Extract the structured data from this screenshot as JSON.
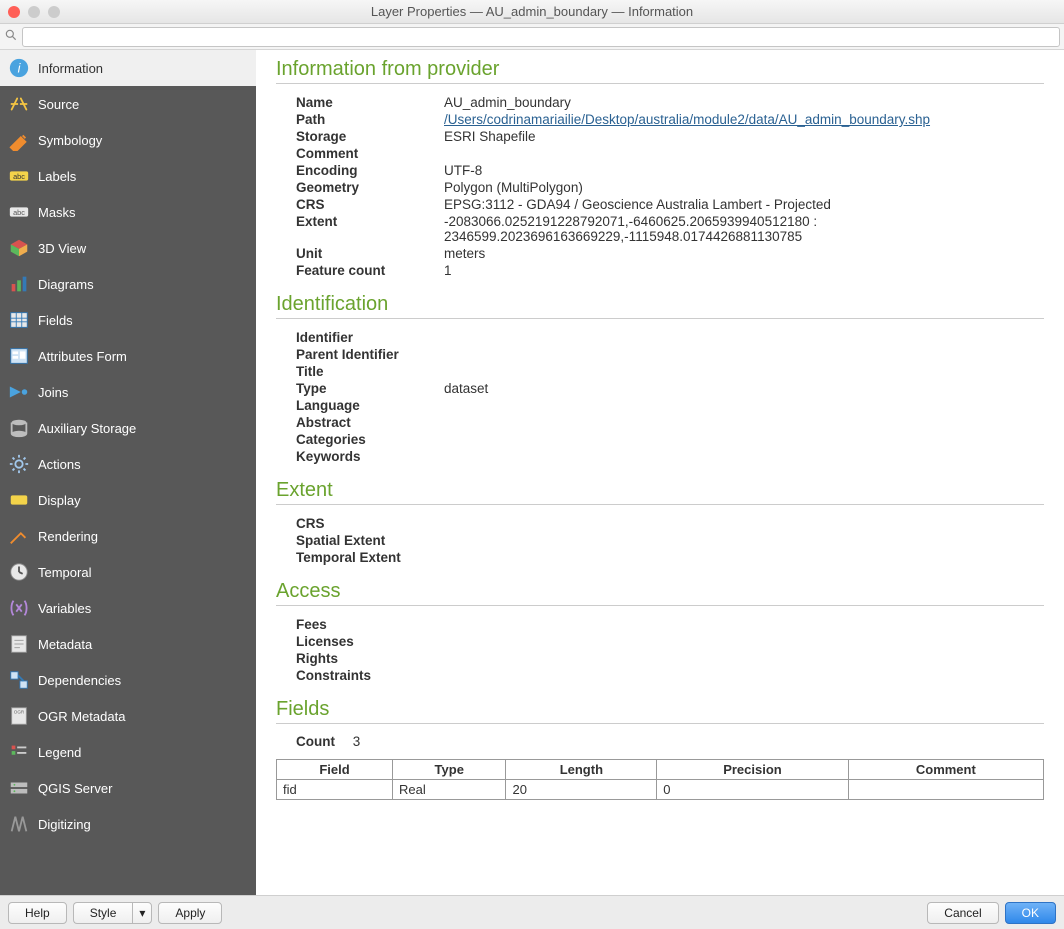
{
  "window": {
    "title": "Layer Properties — AU_admin_boundary — Information"
  },
  "search": {
    "placeholder": ""
  },
  "sidebar": {
    "items": [
      {
        "label": "Information",
        "selected": true,
        "icon": "info-icon"
      },
      {
        "label": "Source",
        "selected": false,
        "icon": "source-icon"
      },
      {
        "label": "Symbology",
        "selected": false,
        "icon": "symbology-icon"
      },
      {
        "label": "Labels",
        "selected": false,
        "icon": "labels-icon"
      },
      {
        "label": "Masks",
        "selected": false,
        "icon": "masks-icon"
      },
      {
        "label": "3D View",
        "selected": false,
        "icon": "3dview-icon"
      },
      {
        "label": "Diagrams",
        "selected": false,
        "icon": "diagrams-icon"
      },
      {
        "label": "Fields",
        "selected": false,
        "icon": "fields-icon"
      },
      {
        "label": "Attributes Form",
        "selected": false,
        "icon": "attributesform-icon"
      },
      {
        "label": "Joins",
        "selected": false,
        "icon": "joins-icon"
      },
      {
        "label": "Auxiliary Storage",
        "selected": false,
        "icon": "auxstorage-icon"
      },
      {
        "label": "Actions",
        "selected": false,
        "icon": "actions-icon"
      },
      {
        "label": "Display",
        "selected": false,
        "icon": "display-icon"
      },
      {
        "label": "Rendering",
        "selected": false,
        "icon": "rendering-icon"
      },
      {
        "label": "Temporal",
        "selected": false,
        "icon": "temporal-icon"
      },
      {
        "label": "Variables",
        "selected": false,
        "icon": "variables-icon"
      },
      {
        "label": "Metadata",
        "selected": false,
        "icon": "metadata-icon"
      },
      {
        "label": "Dependencies",
        "selected": false,
        "icon": "dependencies-icon"
      },
      {
        "label": "OGR Metadata",
        "selected": false,
        "icon": "ogrmetadata-icon"
      },
      {
        "label": "Legend",
        "selected": false,
        "icon": "legend-icon"
      },
      {
        "label": "QGIS Server",
        "selected": false,
        "icon": "qgisserver-icon"
      },
      {
        "label": "Digitizing",
        "selected": false,
        "icon": "digitizing-icon"
      }
    ]
  },
  "sections": {
    "provider_heading": "Information from provider",
    "identification_heading": "Identification",
    "extent_heading": "Extent",
    "access_heading": "Access",
    "fields_heading": "Fields"
  },
  "provider": {
    "rows": [
      {
        "k": "Name",
        "v": "AU_admin_boundary",
        "link": false
      },
      {
        "k": "Path",
        "v": "/Users/codrinamariailie/Desktop/australia/module2/data/AU_admin_boundary.shp",
        "link": true
      },
      {
        "k": "Storage",
        "v": "ESRI Shapefile",
        "link": false
      },
      {
        "k": "Comment",
        "v": "",
        "link": false
      },
      {
        "k": "Encoding",
        "v": "UTF-8",
        "link": false
      },
      {
        "k": "Geometry",
        "v": "Polygon (MultiPolygon)",
        "link": false
      },
      {
        "k": "CRS",
        "v": "EPSG:3112 - GDA94 / Geoscience Australia Lambert - Projected",
        "link": false
      },
      {
        "k": "Extent",
        "v": "-2083066.0252191228792071,-6460625.2065939940512180 : 2346599.2023696163669229,-1115948.0174426881130785",
        "link": false
      },
      {
        "k": "Unit",
        "v": "meters",
        "link": false
      },
      {
        "k": "Feature count",
        "v": "1",
        "link": false
      }
    ]
  },
  "identification": {
    "rows": [
      {
        "k": "Identifier",
        "v": ""
      },
      {
        "k": "Parent Identifier",
        "v": ""
      },
      {
        "k": "Title",
        "v": ""
      },
      {
        "k": "Type",
        "v": "dataset"
      },
      {
        "k": "Language",
        "v": ""
      },
      {
        "k": "Abstract",
        "v": ""
      },
      {
        "k": "Categories",
        "v": ""
      },
      {
        "k": "Keywords",
        "v": ""
      }
    ]
  },
  "extent": {
    "rows": [
      {
        "k": "CRS",
        "v": ""
      },
      {
        "k": "Spatial Extent",
        "v": ""
      },
      {
        "k": "Temporal Extent",
        "v": ""
      }
    ]
  },
  "access": {
    "rows": [
      {
        "k": "Fees",
        "v": ""
      },
      {
        "k": "Licenses",
        "v": ""
      },
      {
        "k": "Rights",
        "v": ""
      },
      {
        "k": "Constraints",
        "v": ""
      }
    ]
  },
  "fields": {
    "count_label": "Count",
    "count_value": "3",
    "headers": [
      "Field",
      "Type",
      "Length",
      "Precision",
      "Comment"
    ],
    "rows": [
      {
        "field": "fid",
        "type": "Real",
        "length": "20",
        "precision": "0",
        "comment": ""
      }
    ]
  },
  "buttons": {
    "help": "Help",
    "style": "Style",
    "style_dd": "▾",
    "apply": "Apply",
    "cancel": "Cancel",
    "ok": "OK"
  }
}
